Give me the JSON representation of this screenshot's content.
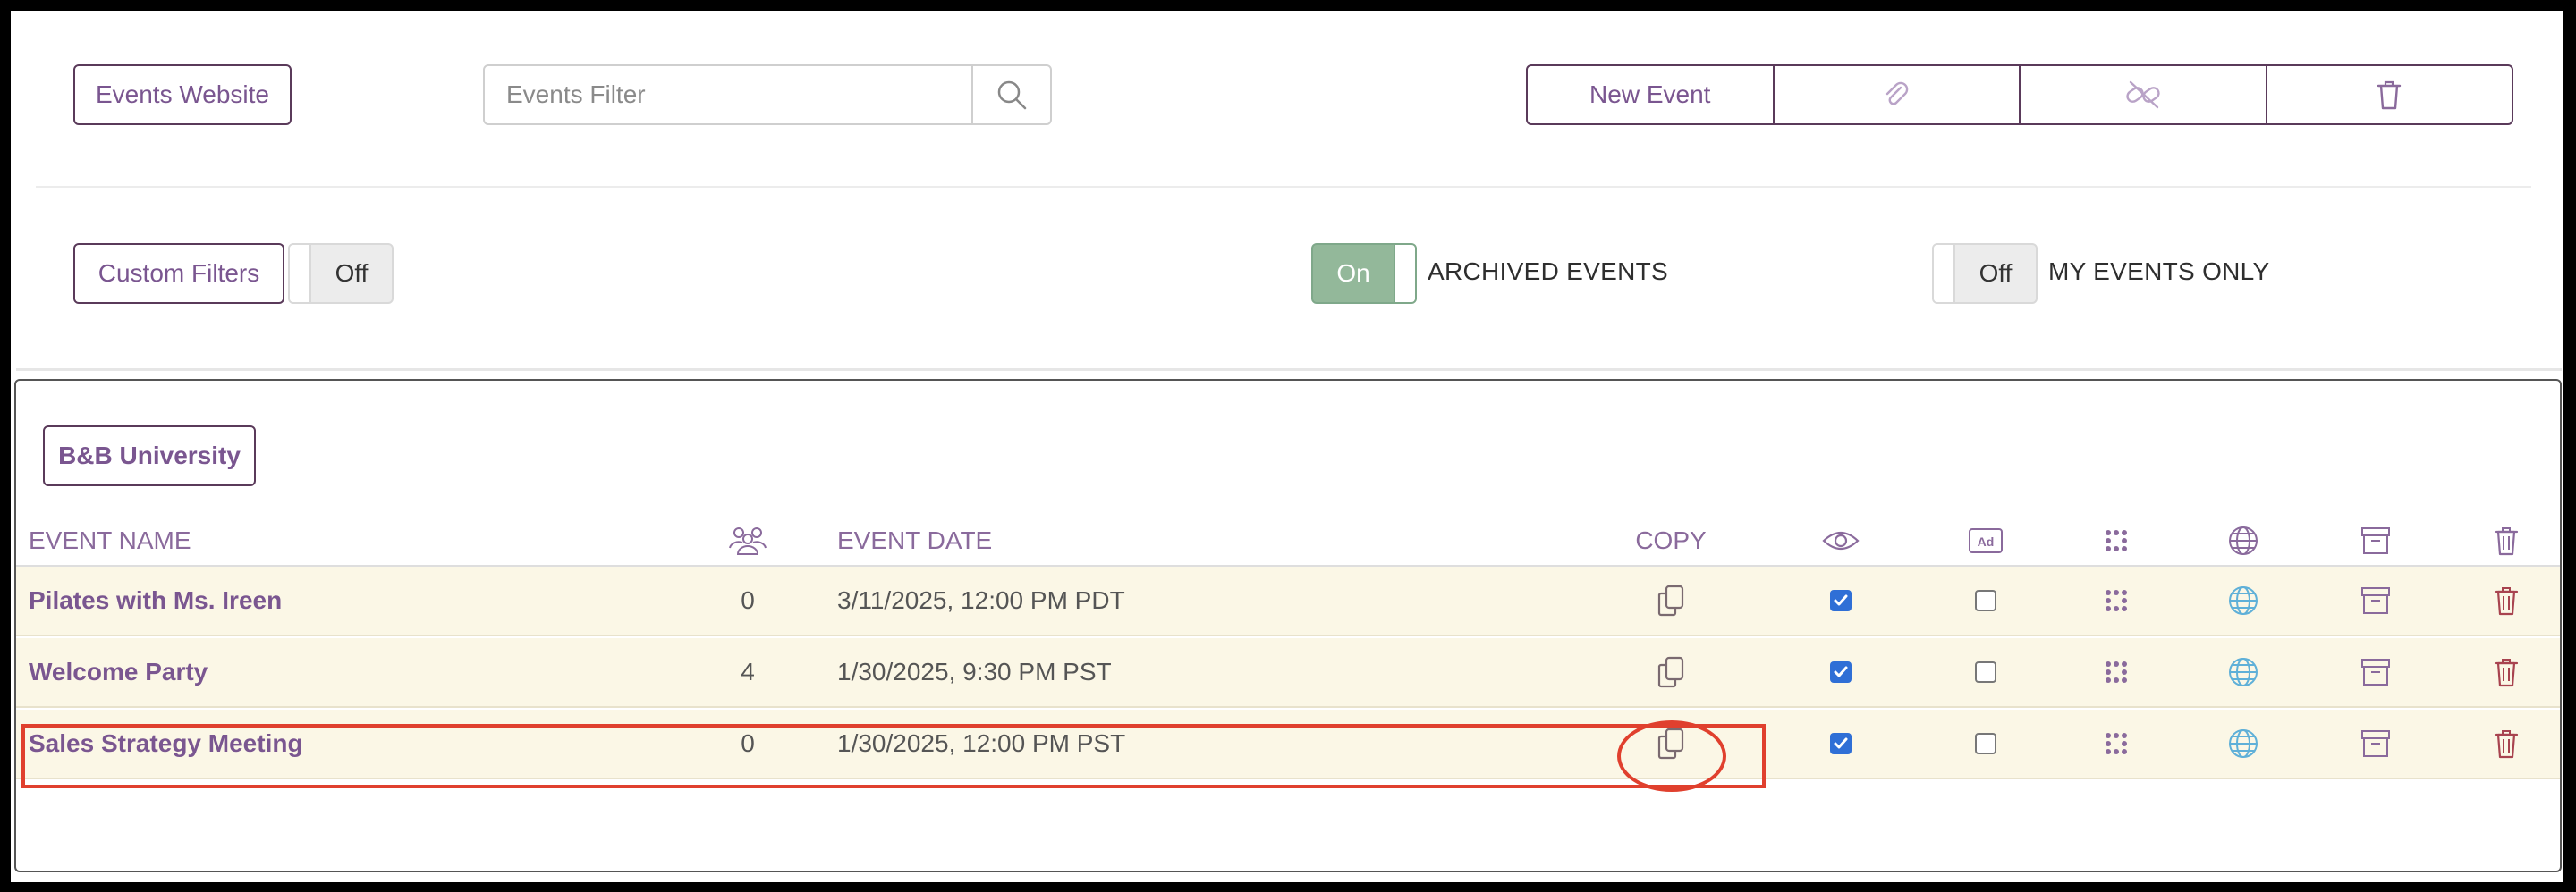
{
  "toolbar": {
    "events_website_label": "Events Website",
    "search_placeholder": "Events Filter",
    "new_event_label": "New Event",
    "icons": [
      "paperclip-icon",
      "unlink-icon",
      "trash-icon"
    ]
  },
  "filters": {
    "custom_filters_label": "Custom Filters",
    "custom_filters_state": "Off",
    "archived_state": "On",
    "archived_label": "ARCHIVED EVENTS",
    "my_events_state": "Off",
    "my_events_label": "MY EVENTS ONLY"
  },
  "group": {
    "name": "B&B University"
  },
  "table": {
    "headers": {
      "event_name": "EVENT NAME",
      "attendees_icon": "people-icon",
      "event_date": "EVENT DATE",
      "copy": "COPY",
      "visible_icon": "eye-icon",
      "ad_icon": "ad-icon",
      "qr_icon": "grid-dots-icon",
      "web_icon": "globe-icon",
      "archive_icon": "archive-icon",
      "delete_icon": "trash-icon"
    },
    "rows": [
      {
        "name": "Pilates with Ms. Ireen",
        "count": "0",
        "date": "3/11/2025, 12:00 PM PDT",
        "visible": true,
        "ad": false
      },
      {
        "name": "Welcome Party",
        "count": "4",
        "date": "1/30/2025, 9:30 PM PST",
        "visible": true,
        "ad": false
      },
      {
        "name": "Sales Strategy Meeting",
        "count": "0",
        "date": "1/30/2025, 12:00 PM PST",
        "visible": true,
        "ad": false
      }
    ]
  },
  "colors": {
    "brand_purple": "#7a5690",
    "row_bg": "#fbf7e6",
    "toggle_on": "#93b89a",
    "checkbox_blue": "#2f6fd6",
    "globe_blue": "#5fb0d8",
    "delete_red": "#a8434f",
    "highlight_red": "#e0402e"
  }
}
